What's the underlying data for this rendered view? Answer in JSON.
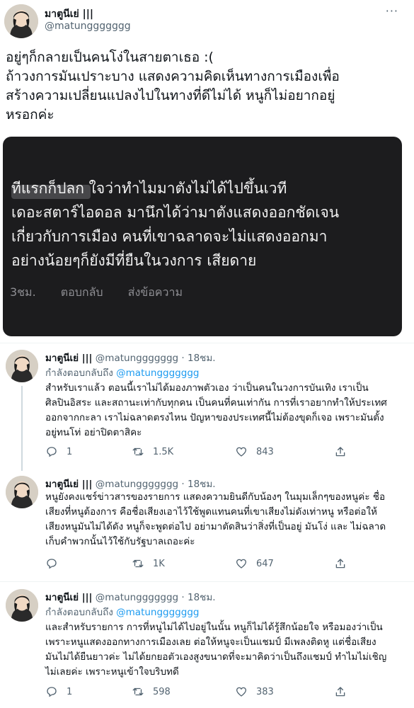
{
  "main": {
    "name": "มาตูนีเย่ |||",
    "handle": "@matunggggggg",
    "more": "···",
    "text_lines": [
      "อยู่ๆก็กลายเป็นคนโง่ในสายตาเธอ :(",
      "ถ้าวงการมันเปราะบาง แสดงความคิดเห็นทางการเมืองเพื่อ",
      "สร้างความเปลี่ยนแปลงไปในทางที่ดีไม่ได้ หนูก็ไม่อยากอยู่",
      "หรอกค่ะ"
    ]
  },
  "media": {
    "text_lines": [
      "                ทีแรกก็ปลก ใจว่าทำไมมาตังไม่ได้ไปขึ้นเวที",
      "เดอะสตาร์ไอดอล มานึกได้ว่ามาตังแสดงออกชัดเจน",
      "เกี่ยวกับการเมือง  คนที่เขาฉลาดจะไม่แสดงออกมา",
      "อย่างน้อยๆก็ยังมีที่ยืนในวงการ เสียดาย"
    ],
    "meta": [
      "3ชม.",
      "ตอบกลับ",
      "ส่งข้อความ"
    ]
  },
  "replies": [
    {
      "name": "มาตูนีเย่ |||",
      "handle": "@matunggggggg",
      "time": "· 18ชม.",
      "replying_prefix": "กำลังตอบกลับถึง ",
      "replying_to": "@matunggggggg",
      "lines": [
        "สำหรับเราแล้ว ตอนนี้เราไม่ได้มองภาพตัวเอง ว่าเป็นคนในวงการบันเทิง เราเป็น",
        "ศิลปินอิสระ และสถานะเท่ากับทุกคน เป็นคนที่คนเท่ากัน การที่เราอยากทำให้ประเทศ",
        "ออกจากกะลา เราไม่ฉลาดตรงไหน ปัญหาของประเทศนี้ไม่ต้องขุดก็เจอ เพราะมันตั้ง",
        "อยู่ทนโท่ อย่าปิดตาสิคะ"
      ],
      "replies": "1",
      "retweets": "1.5K",
      "likes": "843"
    },
    {
      "name": "มาตูนีเย่ |||",
      "handle": "@matunggggggg",
      "time": "· 18ชม.",
      "replying_prefix": "",
      "replying_to": "",
      "lines": [
        "หนูยังคงแชร์ข่าวสารของรายการ แสดงความยินดีกับน้องๆ ในมุมเล็กๆของหนูค่ะ ชื่อ",
        "เสียงที่หนูต้องการ คือชื่อเสียงเอาไว้ใช้พูดแทนคนที่เขาเสียงไม่ดังเท่าหนู หรือต่อให้",
        "เสียงหนูมันไม่ได้ดัง หนูก็จะพูดต่อไป อย่ามาตัดสินว่าสิ่งที่เป็นอยู่ มันโง่ และ ไม่ฉลาด",
        "เก็บคำพวกนั้นไว้ใช้กับรัฐบาลเถอะค่ะ"
      ],
      "replies": "",
      "retweets": "1K",
      "likes": "647"
    },
    {
      "name": "มาตูนีเย่ |||",
      "handle": "@matunggggggg",
      "time": "· 18ชม.",
      "replying_prefix": "กำลังตอบกลับถึง ",
      "replying_to": "@matunggggggg",
      "lines": [
        "และสำหรับรายการ การที่หนูไม่ได้ไปอยู่ในนั้น หนูก็ไม่ได้รู้สึกน้อยใจ หรือมองว่าเป็น",
        "เพราะหนูแสดงออกทางการเมืองเลย ต่อให้หนูจะเป็นแชมป์ มีเพลงติดหู แต่ชื่อเสียง",
        "มันไม่ได้ยืนยาวค่ะ ไม่ได้ยกยอตัวเองสูงขนาดที่จะมาคิดว่าเป็นถึงแชมป์ ทำไมไม่เชิญ",
        "ไม่เลยค่ะ เพราะหนูเข้าใจบริบทดี"
      ],
      "replies": "1",
      "retweets": "598",
      "likes": "383"
    }
  ],
  "icons": {
    "avatar": "avatar-portrait",
    "reply": "reply-icon",
    "retweet": "retweet-icon",
    "like": "like-icon",
    "share": "share-icon"
  },
  "colors": {
    "link": "#1d9bf0",
    "muted": "#536471",
    "media_bg": "#1c1c1e"
  }
}
